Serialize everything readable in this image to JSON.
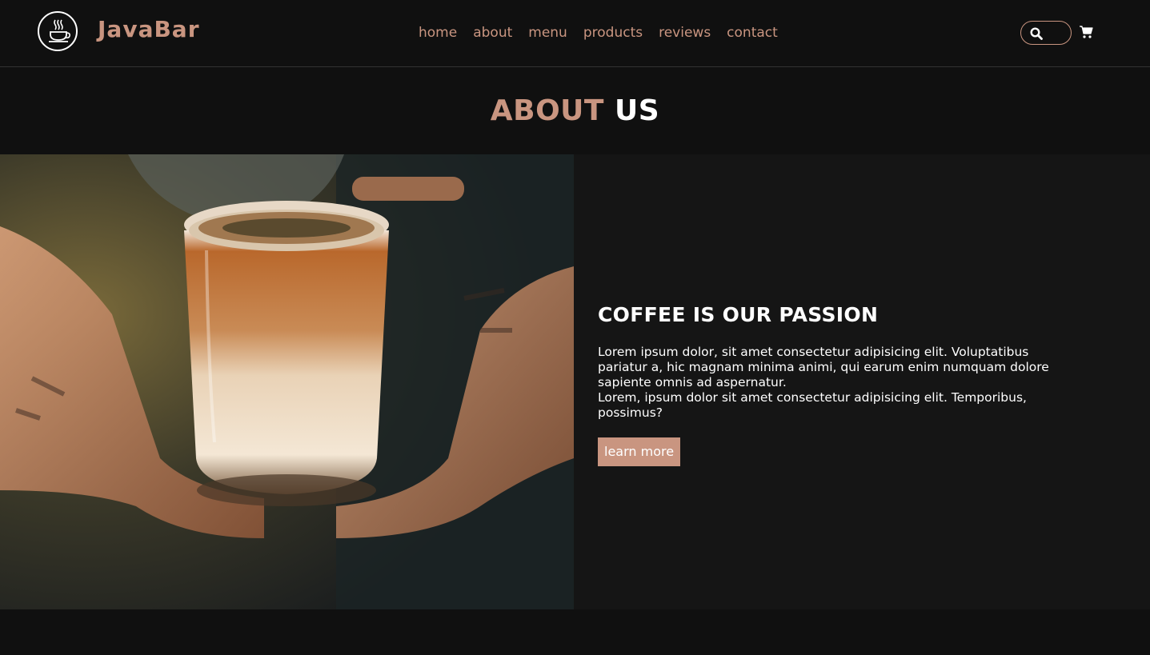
{
  "colors": {
    "accent": "#d3ad7f",
    "accent_alt": "#c99580",
    "background": "#101010",
    "panel": "#151515",
    "text": "#ffffff"
  },
  "header": {
    "brand": "JavaBar",
    "logo_icon": "coffee-cup-icon",
    "nav": [
      "home",
      "about",
      "menu",
      "products",
      "reviews",
      "contact"
    ],
    "search_icon": "search-icon",
    "cart_icon": "cart-icon"
  },
  "about": {
    "title_part1": "ABOUT",
    "title_part2": "US",
    "heading": "COFFEE IS OUR PASSION",
    "paragraph1": "Lorem ipsum dolor, sit amet consectetur adipisicing elit. Voluptatibus pariatur a, hic magnam minima animi, qui earum enim numquam dolore sapiente omnis ad aspernatur.",
    "paragraph2": "Lorem, ipsum dolor sit amet consectetur adipisicing elit. Temporibus, possimus?",
    "button": "learn more",
    "image_alt": "iced-coffee-photo"
  }
}
